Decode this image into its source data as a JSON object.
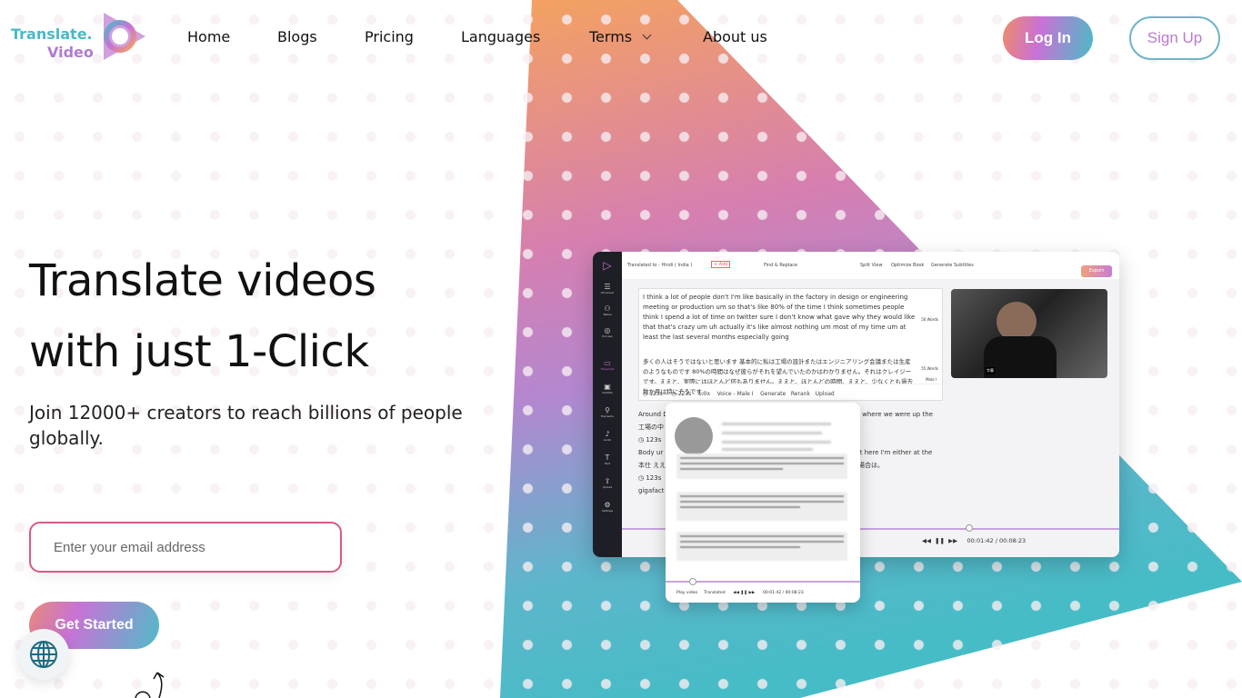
{
  "colors": {
    "brand_teal": "#4bbbc6",
    "brand_purple": "#c971d6",
    "brand_orange": "#f08a6a",
    "input_border": "#d75b84"
  },
  "logo": {
    "line1": "Translate.",
    "line2": "Video"
  },
  "nav": {
    "items": [
      "Home",
      "Blogs",
      "Pricing",
      "Languages",
      "Terms",
      "About us"
    ],
    "terms_icon": "chevron-down-icon",
    "login": "Log In",
    "signup": "Sign Up"
  },
  "hero": {
    "title_line1": "Translate videos",
    "title_line2": "with just 1-Click",
    "subtitle": "Join 12000+ creators to reach billions of people globally.",
    "email_placeholder": "Enter your email address",
    "cta": "Get Started"
  },
  "mockup": {
    "translated_to": "Translated to - Hindi ( India )",
    "add": "+ Add",
    "toolbar": [
      "Find & Replace",
      "Split View",
      "Optimize Book",
      "Generate Subtitles"
    ],
    "export": "Export",
    "sidebar": [
      "Voiceover",
      "Tables",
      "Process",
      "Transcript",
      "Subtitle",
      "Elements",
      "Audio",
      "Text",
      "Upload",
      "Settings"
    ],
    "segment_en": "I think a lot of people don't I'm like basically in the factory in design or engineering meeting or production um so that's like 80% of the time I think sometimes people think I spend a lot of time on twitter sure I don't know what gave why they would like that that's crazy um uh actually it's like almost nothing um most of my time um at least the last several months especially going",
    "segment_jp": "多くの人はそうではないと思います 基本的に私は工場の設計またはエンジニアリング会議または生産のようなものです 80%の時間はなぜ彼らがそれを望んでいたのかはわかりません。それはクレイジーです。ええと、実際にはほとんど何もありません。ええと、ほとんどの時間、ええと、少なくとも過去数か月は特にそうです。",
    "words_1": "50 Words",
    "words_2": "55 Words",
    "voice_tag": "Male I",
    "start": "123s",
    "end": "223s",
    "speed": "1.0x",
    "voice": "Voice - Male I",
    "generate": "Generate",
    "rerank": "Rerank",
    "upload": "Upload",
    "line_a": "Around D",
    "line_a2": "up where we were up the",
    "line_b": "工場の中",
    "line_c": "Body ur",
    "line_c2": "not here I'm either at the",
    "line_d": "本仕 ええ",
    "line_d2": "い場合は。",
    "line_e": "gigafact",
    "time": "00:01:42 / 00:08:23",
    "popup_play": "Play video",
    "popup_translated": "Translated",
    "popup_time": "00:01:42 / 00:08:23"
  }
}
